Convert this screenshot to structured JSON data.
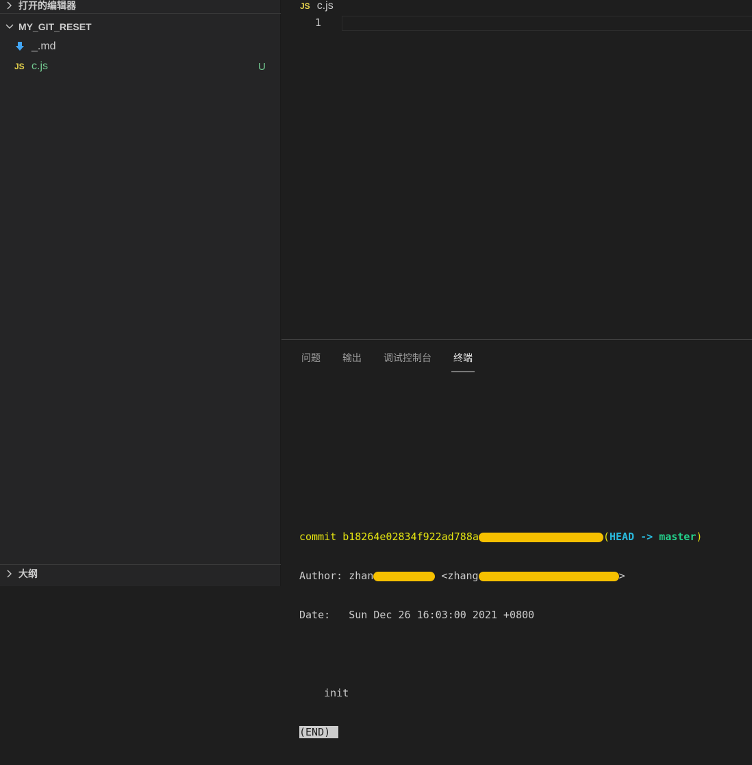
{
  "sidebar": {
    "open_editors_label": "打开的编辑器",
    "workspace_label": "MY_GIT_RESET",
    "files": [
      {
        "name": "_.md",
        "icon": "markdown-icon"
      },
      {
        "name": "c.js",
        "icon": "js-file-icon",
        "badge": "JS",
        "git_status": "U"
      }
    ],
    "outline_label": "大纲"
  },
  "editor": {
    "tab_badge": "JS",
    "tab_label": "c.js",
    "line_numbers": [
      "1"
    ]
  },
  "panel": {
    "tabs": [
      "问题",
      "输出",
      "调试控制台",
      "终端"
    ],
    "active_tab": "终端"
  },
  "terminal": {
    "commit_prefix": "commit b18264e02834f922ad788a",
    "head_open": "(",
    "head_label": "HEAD",
    "head_arrow": " -> ",
    "branch_label": "master",
    "head_close": ")",
    "author_prefix": "Author: zhan",
    "author_email_prefix": " <zhang",
    "author_email_suffix": ">",
    "date_line": "Date:   Sun Dec 26 16:03:00 2021 +0800",
    "message_line": "    init",
    "pager_end": "(END)"
  },
  "colors": {
    "js_badge": "#e8d44d",
    "untracked_green": "#73c991",
    "terminal_yellow": "#e5e510",
    "terminal_cyan": "#29b8db",
    "terminal_green": "#23d18b",
    "redaction": "#f6c000"
  }
}
